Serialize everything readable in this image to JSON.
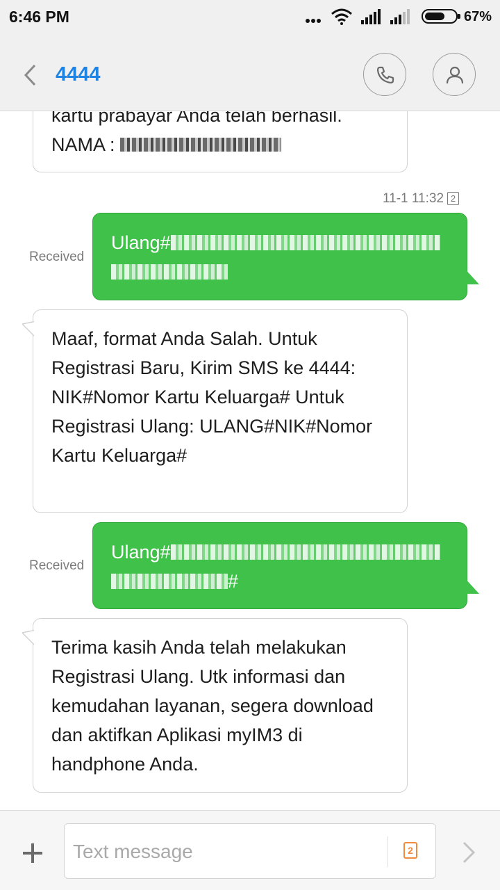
{
  "status_bar": {
    "time": "6:46 PM",
    "battery_percent": "67%",
    "battery_level": 0.67
  },
  "header": {
    "title": "4444",
    "back_icon": "chevron-left-icon",
    "call_icon": "phone-icon",
    "contact_icon": "person-icon",
    "title_color": "#1d83e5"
  },
  "messages": [
    {
      "direction": "incoming",
      "lines": [
        "kartu prabayar Anda telah berhasil.",
        "NAMA :"
      ]
    },
    {
      "timestamp": "11-1 11:32",
      "sim_badge": "2"
    },
    {
      "direction": "outgoing",
      "status": "Received",
      "line1_prefix": "Ulang#",
      "line2_suffix": ""
    },
    {
      "direction": "incoming",
      "text": "Maaf, format Anda Salah. Untuk Registrasi Baru, Kirim SMS ke 4444: NIK#Nomor Kartu Keluarga# Untuk Registrasi Ulang: ULANG#NIK#Nomor Kartu Keluarga#"
    },
    {
      "direction": "outgoing",
      "status": "Received",
      "line1_prefix": "Ulang#",
      "line2_suffix": "#"
    },
    {
      "direction": "incoming",
      "text": "Terima kasih Anda telah melakukan Registrasi Ulang. Utk informasi dan kemudahan layanan, segera download dan aktifkan Aplikasi myIM3 di handphone Anda."
    }
  ],
  "compose": {
    "placeholder": "Text message",
    "sim_badge": "2",
    "add_icon": "plus-icon",
    "send_icon": "chevron-right-icon"
  },
  "colors": {
    "outgoing_bubble": "#3fc14a",
    "incoming_bubble": "#ffffff",
    "sim_badge": "#f08a3c"
  }
}
